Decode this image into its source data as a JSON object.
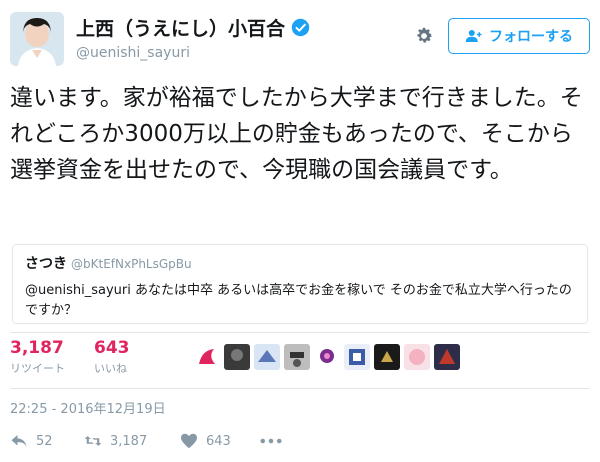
{
  "user": {
    "display_name": "上西（うえにし）小百合",
    "handle": "@uenishi_sayuri"
  },
  "follow_button": {
    "label": "フォローする"
  },
  "tweet": {
    "text": "違います。家が裕福でしたから大学まで行きました。それどころか3000万以上の貯金もあったので、そこから選挙資金を出せたので、今現職の国会議員です。"
  },
  "quote": {
    "name": "さつき",
    "handle": "@bKtEfNxPhLsGpBu",
    "text": "@uenishi_sayuri あなたは中卒 あるいは高卒でお金を稼いで そのお金で私立大学へ行ったのですか？"
  },
  "stats": {
    "retweets": {
      "count": "3,187",
      "label": "リツイート"
    },
    "likes": {
      "count": "643",
      "label": "いいね"
    }
  },
  "timestamp": "22:25 - 2016年12月19日",
  "actions": {
    "reply_count": "52",
    "retweet_count": "3,187",
    "like_count": "643"
  },
  "colors": {
    "accent": "#1da1f2",
    "stat_highlight": "#e0245e",
    "muted": "#8899a6",
    "border": "#e1e8ed"
  },
  "icons": [
    "avatar",
    "verified-badge-icon",
    "gear-icon",
    "follow-person-icon",
    "reply-icon",
    "retweet-icon",
    "heart-icon",
    "more-icon"
  ]
}
